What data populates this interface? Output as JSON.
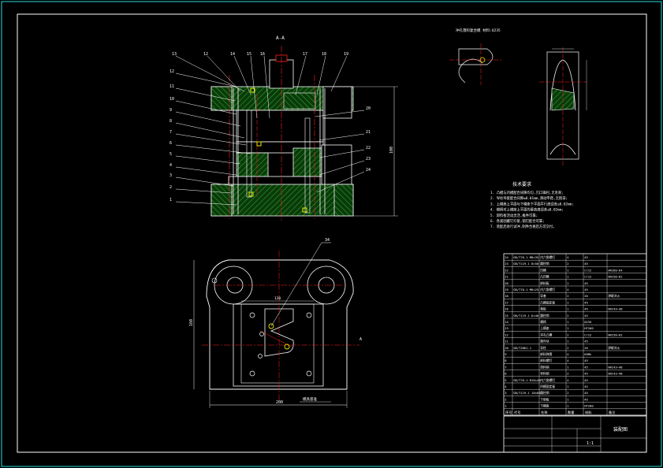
{
  "section_label": "A-A",
  "callouts_top": [
    "13",
    "12",
    "14",
    "15",
    "16",
    "17",
    "18",
    "19"
  ],
  "callouts_left": [
    "12",
    "11",
    "10",
    "9",
    "8",
    "7",
    "6",
    "5",
    "4",
    "3",
    "2",
    "1"
  ],
  "callouts_right": [
    "20",
    "21",
    "22",
    "23",
    "24"
  ],
  "dim_height": "100",
  "part_title": "冲孔落料复合模 材料:Q235",
  "tech_title": "技术要求",
  "tech_lines": [
    "1. 凸模与凹模配合间隙均匀,刃口锋利,无毛刺;",
    "2. 导柱导套配合间隙≤0.01mm,滑动平稳,无阻滞;",
    "3. 上模座上平面与下模座下平面平行度误差≤0.02mm;",
    "4. 模柄对上模座上平面的垂直度误差≤0.02mm;",
    "5. 卸料板活动灵活,推件可靠;",
    "6. 各紧固螺钉拧紧,销钉配合可靠;",
    "7. 装配后进行试冲,制件合格后方可交付。"
  ],
  "plan_callout": "34",
  "dim_plan_bottom": "200",
  "dim_plan_side": "160",
  "dim_inner": "120",
  "plan_note": "模具基准",
  "bom_rows": [
    [
      "24",
      "GB/T70.1 M8×35",
      "内六角螺钉",
      "4",
      "45",
      ""
    ],
    [
      "23",
      "GB/T119.1 8×50",
      "圆柱销",
      "2",
      "45",
      ""
    ],
    [
      "22",
      "",
      "凹模",
      "1",
      "Cr12",
      "HRC60~64"
    ],
    [
      "21",
      "",
      "凸凹模",
      "1",
      "Cr12",
      "HRC58~62"
    ],
    [
      "20",
      "",
      "卸料板",
      "1",
      "45",
      ""
    ],
    [
      "19",
      "GB/T70.1 M6×25",
      "内六角螺钉",
      "4",
      "45",
      ""
    ],
    [
      "18",
      "",
      "导套",
      "2",
      "20",
      "渗碳淬火"
    ],
    [
      "17",
      "",
      "凸模固定板",
      "1",
      "45",
      ""
    ],
    [
      "16",
      "",
      "垫板",
      "1",
      "45",
      "HRC43~48"
    ],
    [
      "15",
      "GB/T119.1 6×40",
      "圆柱销",
      "2",
      "45",
      ""
    ],
    [
      "14",
      "",
      "模柄",
      "1",
      "Q235",
      ""
    ],
    [
      "13",
      "",
      "上模座",
      "1",
      "HT200",
      ""
    ],
    [
      "12",
      "",
      "冲孔凸模",
      "2",
      "Cr12",
      "HRC58~62"
    ],
    [
      "11",
      "",
      "推件块",
      "1",
      "45",
      ""
    ],
    [
      "10",
      "GB/T2861.1",
      "导柱",
      "2",
      "20",
      "渗碳淬火"
    ],
    [
      "9",
      "",
      "卸料弹簧",
      "4",
      "65Mn",
      ""
    ],
    [
      "8",
      "",
      "卸料螺钉",
      "4",
      "45",
      ""
    ],
    [
      "7",
      "",
      "挡料销",
      "1",
      "45",
      "HRC43~48"
    ],
    [
      "6",
      "",
      "导料销",
      "2",
      "45",
      "HRC43~48"
    ],
    [
      "5",
      "GB/T70.1 M10×40",
      "内六角螺钉",
      "4",
      "45",
      ""
    ],
    [
      "4",
      "",
      "凹模固定板",
      "1",
      "45",
      ""
    ],
    [
      "3",
      "GB/T119.1 10×60",
      "圆柱销",
      "2",
      "45",
      ""
    ],
    [
      "2",
      "",
      "下垫板",
      "1",
      "45",
      ""
    ],
    [
      "1",
      "",
      "下模座",
      "1",
      "HT200",
      ""
    ]
  ],
  "bom_header": [
    "序号",
    "代号",
    "名称",
    "数量",
    "材料",
    "备注"
  ],
  "title_block_name": "装配图",
  "title_block_scale": "1:1",
  "colors": {
    "line": "#ffffff",
    "hatch": "#2a8a2a",
    "center": "#ff2020",
    "cyan": "#00d8d8",
    "yellow": "#e6e600",
    "frame": "#2dd"
  }
}
